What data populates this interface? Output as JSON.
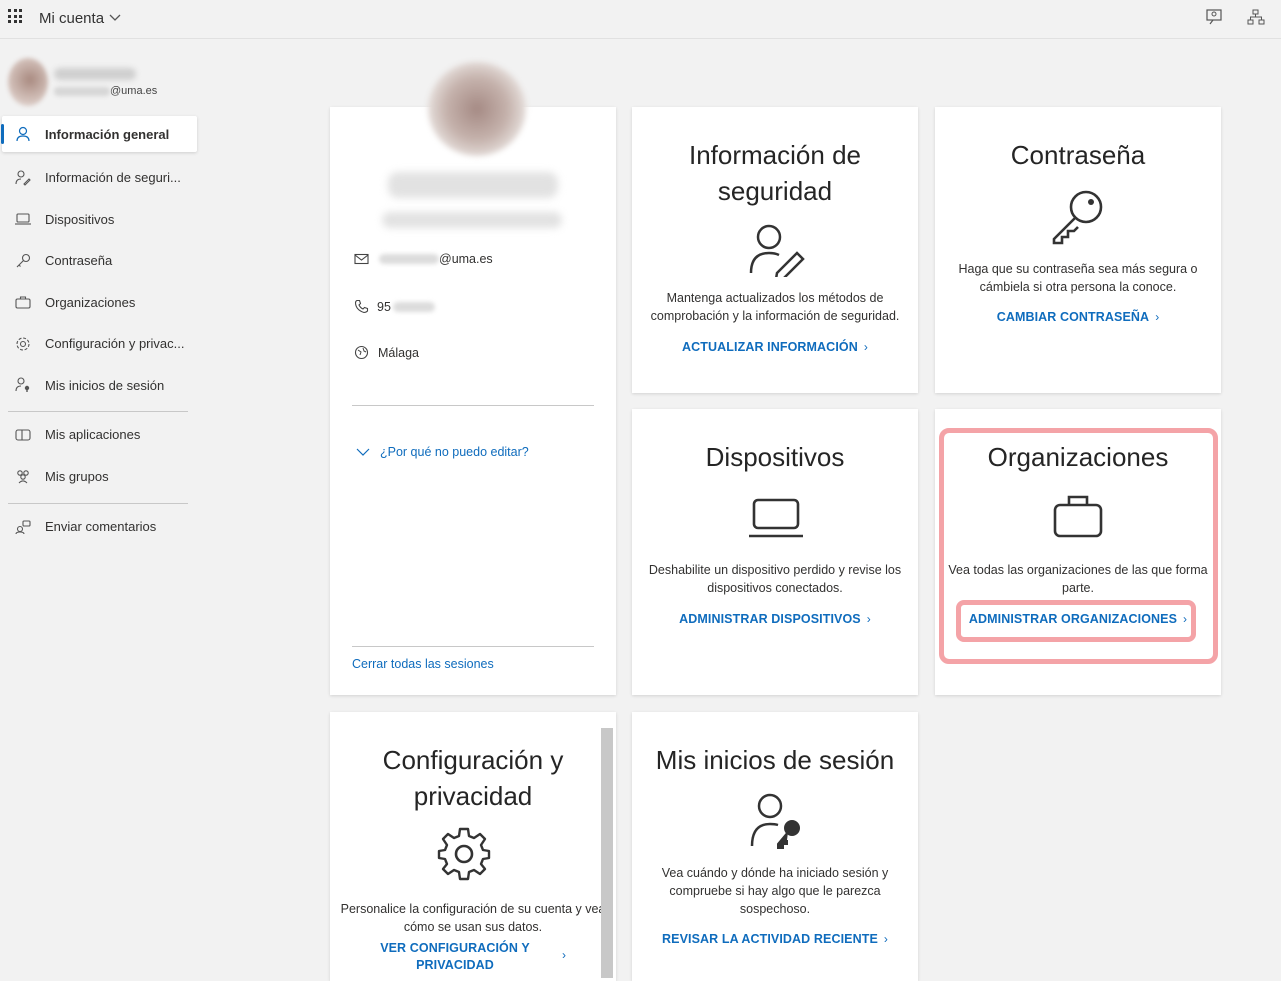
{
  "app": {
    "title": "Mi cuenta"
  },
  "user": {
    "email_domain": "@uma.es"
  },
  "sidebar": {
    "items": [
      {
        "label": "Información general",
        "icon": "person-icon"
      },
      {
        "label": "Información de seguri...",
        "icon": "person-key-icon"
      },
      {
        "label": "Dispositivos",
        "icon": "laptop-icon"
      },
      {
        "label": "Contraseña",
        "icon": "key-icon"
      },
      {
        "label": "Organizaciones",
        "icon": "briefcase-icon"
      },
      {
        "label": "Configuración y privac...",
        "icon": "gear-icon"
      },
      {
        "label": "Mis inicios de sesión",
        "icon": "person-lock-icon"
      },
      {
        "label": "Mis aplicaciones",
        "icon": "apps-icon"
      },
      {
        "label": "Mis grupos",
        "icon": "people-icon"
      },
      {
        "label": "Enviar comentarios",
        "icon": "feedback-icon"
      }
    ]
  },
  "profile": {
    "email_domain": "@uma.es",
    "phone_prefix": "95",
    "location": "Málaga",
    "why_cant_edit": "¿Por qué no puedo editar?",
    "sign_out_all": "Cerrar todas las sesiones"
  },
  "cards": {
    "security": {
      "title": "Información de seguridad",
      "desc": "Mantenga actualizados los métodos de comprobación y la información de seguridad.",
      "link": "ACTUALIZAR INFORMACIÓN"
    },
    "password": {
      "title": "Contraseña",
      "desc": "Haga que su contraseña sea más segura o cámbiela si otra persona la conoce.",
      "link": "CAMBIAR CONTRASEÑA"
    },
    "devices": {
      "title": "Dispositivos",
      "desc": "Deshabilite un dispositivo perdido y revise los dispositivos conectados.",
      "link": "ADMINISTRAR DISPOSITIVOS"
    },
    "organizations": {
      "title": "Organizaciones",
      "desc": "Vea todas las organizaciones de las que forma parte.",
      "link": "ADMINISTRAR ORGANIZACIONES"
    },
    "privacy": {
      "title": "Configuración y privacidad",
      "desc": "Personalice la configuración de su cuenta y vea cómo se usan sus datos.",
      "link": "VER CONFIGURACIÓN Y PRIVACIDAD"
    },
    "signins": {
      "title": "Mis inicios de sesión",
      "desc": "Vea cuándo y dónde ha iniciado sesión y compruebe si hay algo que le parezca sospechoso.",
      "link": "REVISAR LA ACTIVIDAD RECIENTE"
    }
  },
  "colors": {
    "accent": "#0f6cbd",
    "highlight": "#f4a3a7"
  }
}
